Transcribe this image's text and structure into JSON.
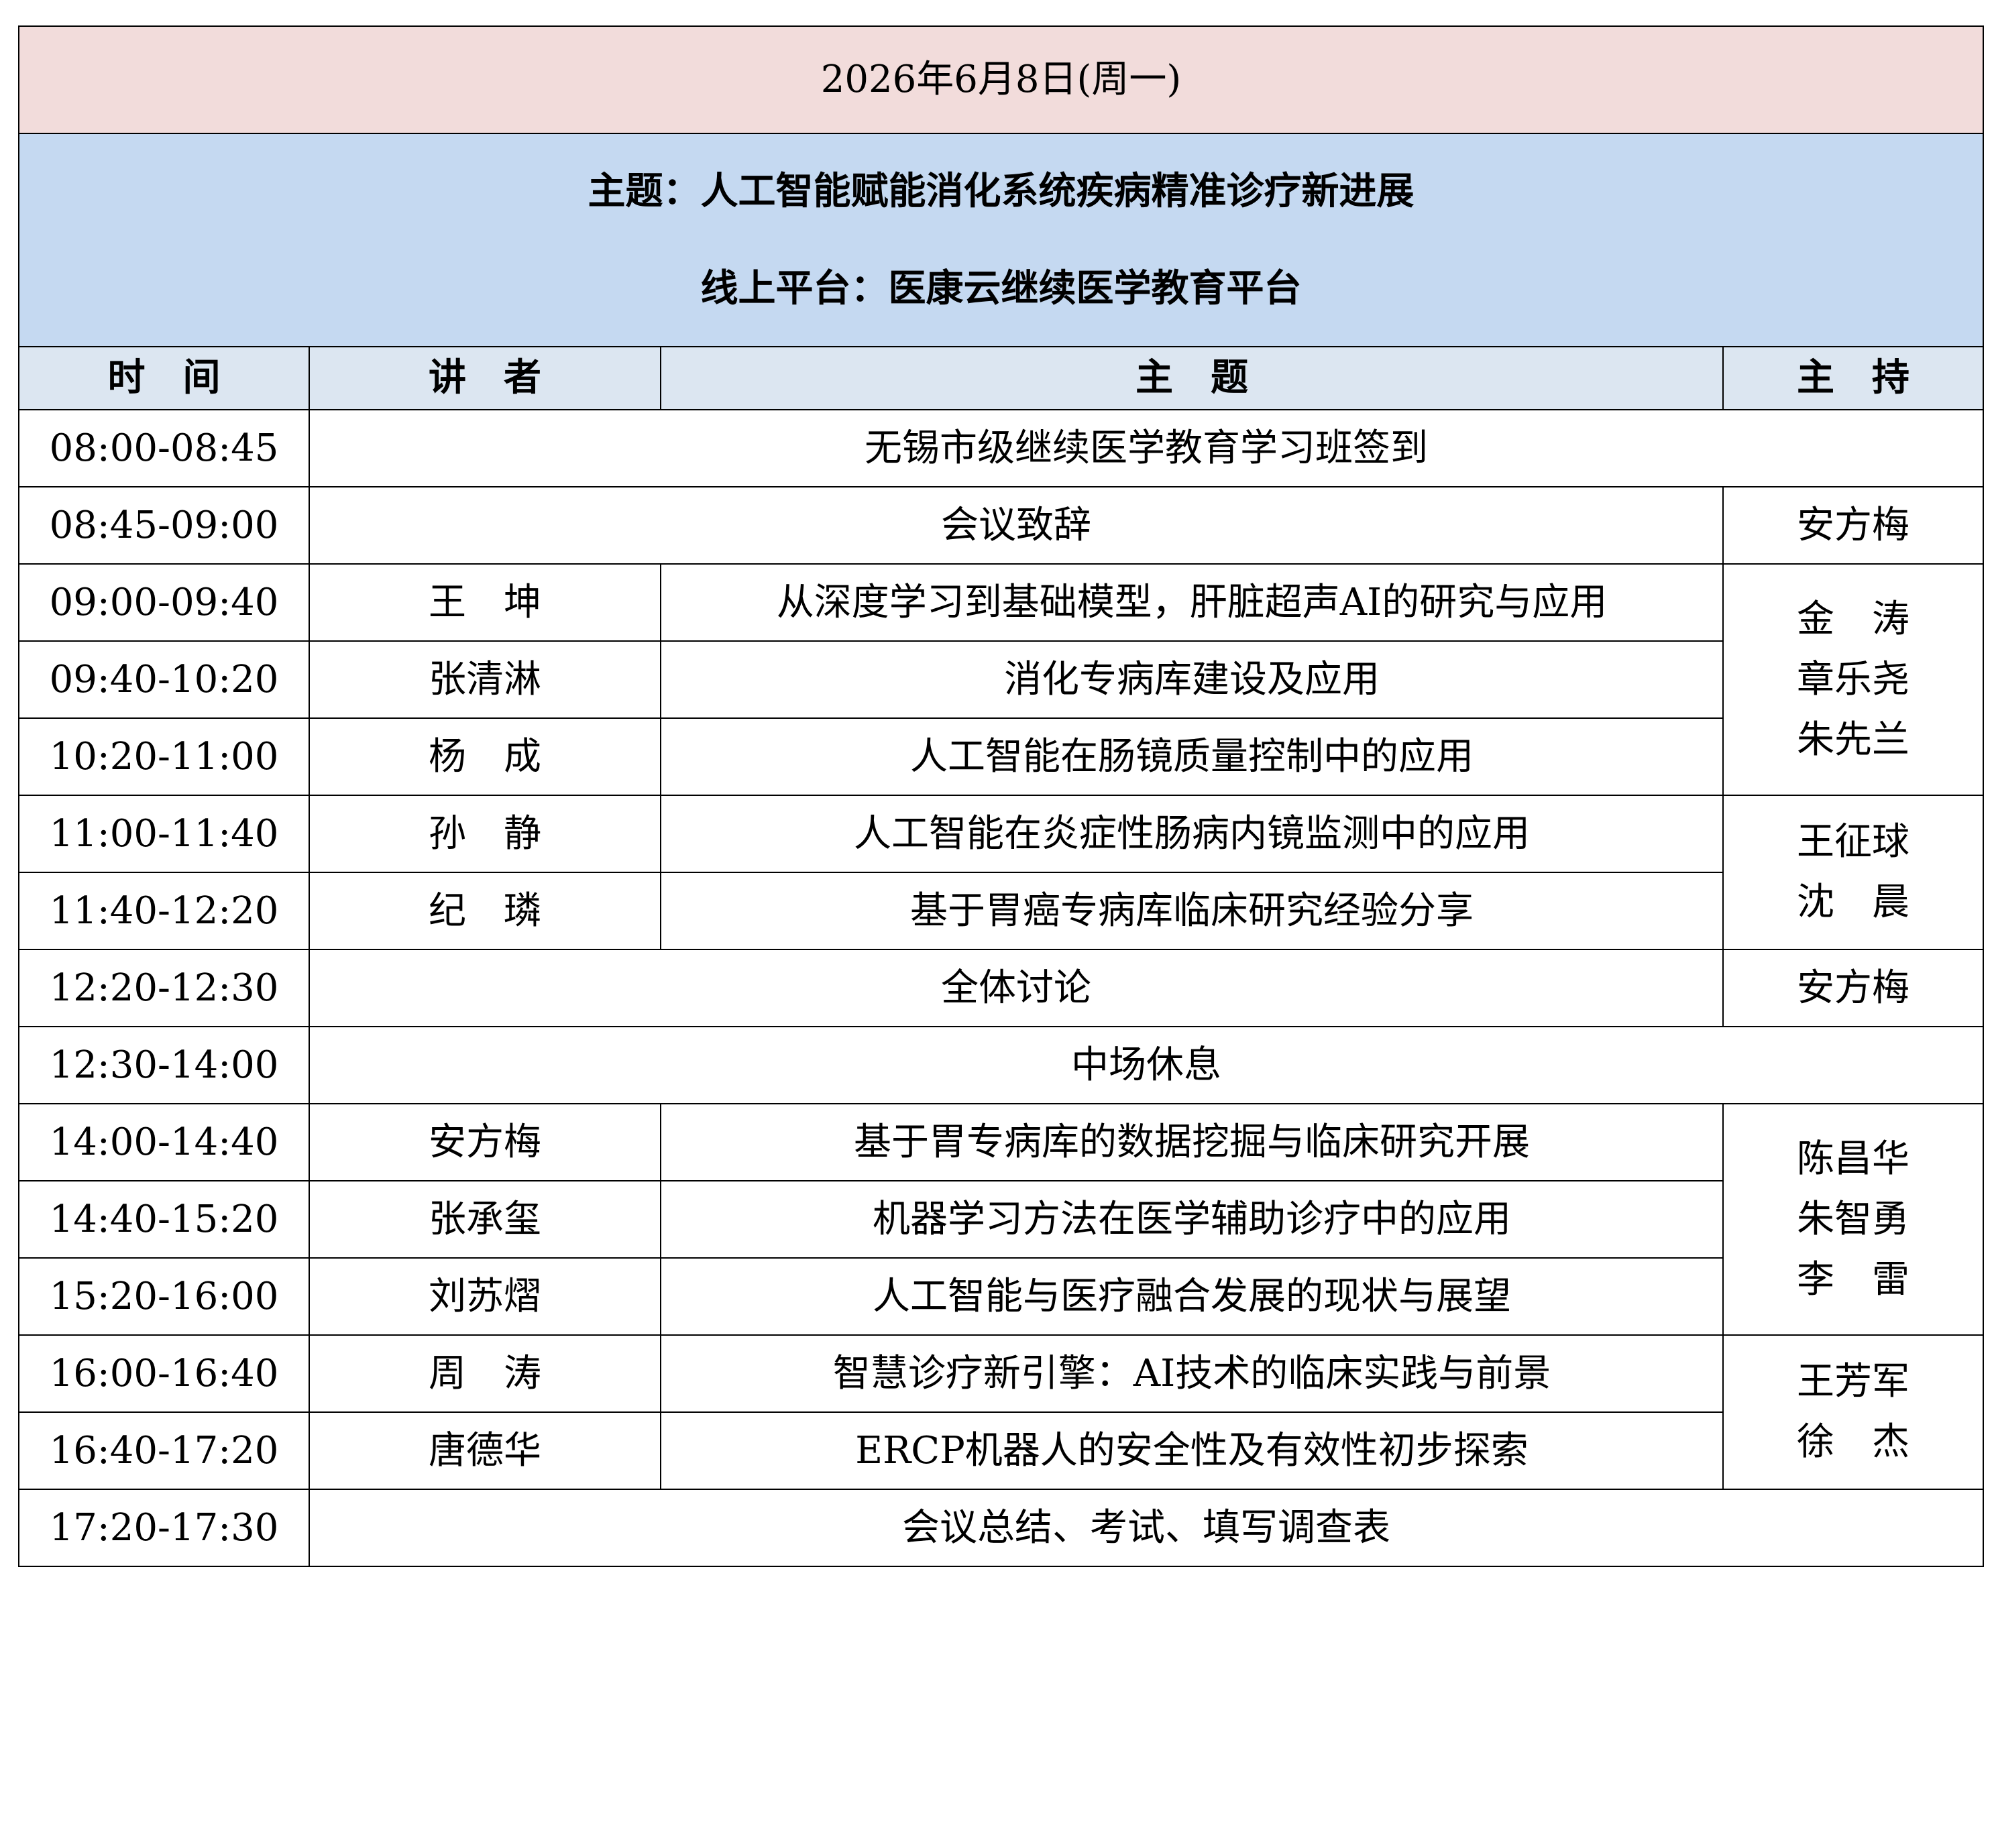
{
  "date_header": "2026年6月8日(周一)",
  "theme_title": "主题：人工智能赋能消化系统疾病精准诊疗新进展",
  "platform": "线上平台：医康云继续医学教育平台",
  "columns": {
    "time": "时　间",
    "speaker": "讲　者",
    "topic": "主　题",
    "host": "主　持"
  },
  "rows": [
    {
      "time": "08:00-08:45",
      "merged": "无锡市级继续医学教育学习班签到"
    },
    {
      "time": "08:45-09:00",
      "merged": "会议致辞",
      "host": "安方梅"
    },
    {
      "time": "09:00-09:40",
      "speaker": "王　坤",
      "topic": "从深度学习到基础模型，肝脏超声AI的研究与应用"
    },
    {
      "time": "09:40-10:20",
      "speaker": "张清淋",
      "topic": "消化专病库建设及应用"
    },
    {
      "time": "10:20-11:00",
      "speaker": "杨　成",
      "topic": "人工智能在肠镜质量控制中的应用"
    },
    {
      "time": "11:00-11:40",
      "speaker": "孙　静",
      "topic": "人工智能在炎症性肠病内镜监测中的应用"
    },
    {
      "time": "11:40-12:20",
      "speaker": "纪　璘",
      "topic": "基于胃癌专病库临床研究经验分享"
    },
    {
      "time": "12:20-12:30",
      "merged": "全体讨论",
      "host": "安方梅"
    },
    {
      "time": "12:30-14:00",
      "merged": "中场休息"
    },
    {
      "time": "14:00-14:40",
      "speaker": "安方梅",
      "topic": "基于胃专病库的数据挖掘与临床研究开展"
    },
    {
      "time": "14:40-15:20",
      "speaker": "张承玺",
      "topic": "机器学习方法在医学辅助诊疗中的应用"
    },
    {
      "time": "15:20-16:00",
      "speaker": "刘苏熠",
      "topic": "人工智能与医疗融合发展的现状与展望"
    },
    {
      "time": "16:00-16:40",
      "speaker": "周　涛",
      "topic": "智慧诊疗新引擎：AI技术的临床实践与前景"
    },
    {
      "time": "16:40-17:20",
      "speaker": "唐德华",
      "topic": "ERCP机器人的安全性及有效性初步探索"
    },
    {
      "time": "17:20-17:30",
      "merged": "会议总结、考试、填写调查表"
    }
  ],
  "host_groups": [
    {
      "names": [
        "金　涛",
        "章乐尧",
        "朱先兰"
      ]
    },
    {
      "names": [
        "王征球",
        "沈　晨"
      ]
    },
    {
      "names": [
        "陈昌华",
        "朱智勇",
        "李　雷"
      ]
    },
    {
      "names": [
        "王芳军",
        "徐　杰"
      ]
    }
  ]
}
